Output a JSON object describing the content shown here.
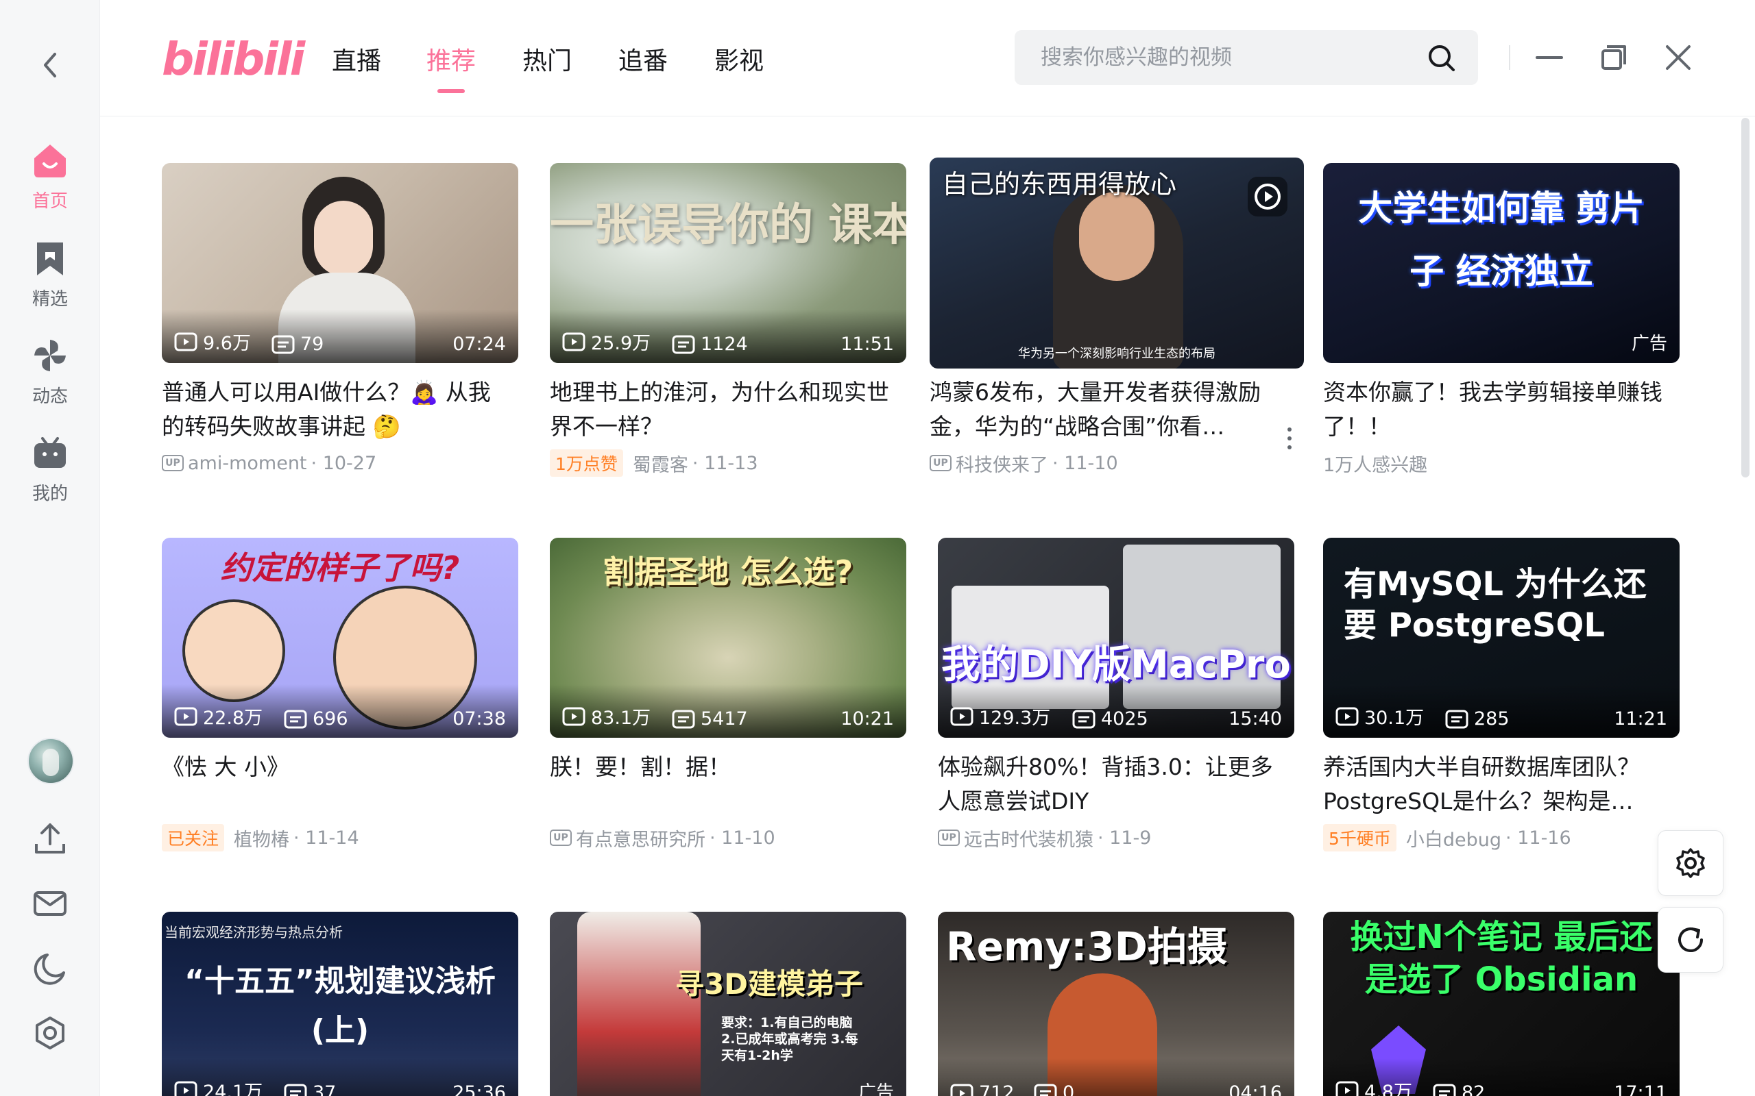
{
  "sidebar": {
    "items": [
      {
        "label": "首页",
        "icon": "home-icon"
      },
      {
        "label": "精选",
        "icon": "bookmark-icon"
      },
      {
        "label": "动态",
        "icon": "pinwheel-icon"
      },
      {
        "label": "我的",
        "icon": "tv-icon"
      }
    ],
    "bottom_icons": [
      "upload-icon",
      "mail-icon",
      "moon-icon",
      "settings-icon"
    ]
  },
  "header": {
    "logo": "bilibili",
    "tabs": [
      "直播",
      "推荐",
      "热门",
      "追番",
      "影视"
    ],
    "active_tab": "推荐",
    "search_placeholder": "搜索你感兴趣的视频"
  },
  "colors": {
    "accent": "#fb7299",
    "tag_orange": "#ff7f24"
  },
  "videos": [
    {
      "overlay": "",
      "views": "9.6万",
      "danmaku": "79",
      "duration": "07:24",
      "title": "普通人可以用AI做什么？🙇‍♀️ 从我的转码失败故事讲起 🤔",
      "author": "ami-moment",
      "date": "· 10-27"
    },
    {
      "overlay": "一张误导你的 课本地图",
      "views": "25.9万",
      "danmaku": "1124",
      "duration": "11:51",
      "title": "地理书上的淮河，为什么和现实世界不一样？",
      "tag": "1万点赞",
      "author": "蜀霞客",
      "date": "· 11-13"
    },
    {
      "overlay": "自己的东西用得放心",
      "caption": "华为另一个深刻影响行业生态的布局",
      "title": "鸿蒙6发布，大量开发者获得激励金，华为的“战略合围”你看…",
      "author": "科技侠来了",
      "date": "· 11-10"
    },
    {
      "overlay": "大学生如何靠 剪片子 经济独立",
      "ad": "广告",
      "title": "资本你赢了！我去学剪辑接单赚钱了！！",
      "interest": "1万人感兴趣"
    },
    {
      "overlay": "约定的样子了吗?",
      "views": "22.8万",
      "danmaku": "696",
      "duration": "07:38",
      "title": "《怯 大 小》",
      "tag": "已关注",
      "author": "植物椿",
      "date": "· 11-14"
    },
    {
      "overlay": "割据圣地 怎么选?",
      "views": "83.1万",
      "danmaku": "5417",
      "duration": "10:21",
      "title": "朕！要！割！据！",
      "author": "有点意思研究所",
      "date": "· 11-10"
    },
    {
      "overlay": "我的DIY版MacPro",
      "views": "129.3万",
      "danmaku": "4025",
      "duration": "15:40",
      "title": "体验飙升80%！背插3.0：让更多人愿意尝试DIY",
      "author": "远古时代装机猿",
      "date": "· 11-9"
    },
    {
      "overlay": "有MySQL 为什么还要 PostgreSQL",
      "views": "30.1万",
      "danmaku": "285",
      "duration": "11:21",
      "title": "养活国内大半自研数据库团队？PostgreSQL是什么？架构是…",
      "tag": "5千硬币",
      "author": "小白debug",
      "date": "· 11-16"
    },
    {
      "overlay": "“十五五”规划建议浅析 (上)",
      "caption": "当前宏观经济形势与热点分析",
      "views": "24.1万",
      "danmaku": "37",
      "duration": "25:36"
    },
    {
      "overlay": "寻3D建模弟子",
      "caption": "要求：1.有自己的电脑 2.已成年或高考完 3.每天有1-2h学",
      "ad": "广告"
    },
    {
      "overlay": "Remy:3D拍摄",
      "views": "712",
      "danmaku": "0",
      "duration": "04:16"
    },
    {
      "overlay": "换过N个笔记 最后还是选了 Obsidian",
      "views": "4.8万",
      "danmaku": "82",
      "duration": "17:11"
    }
  ],
  "up_badge": "UP"
}
